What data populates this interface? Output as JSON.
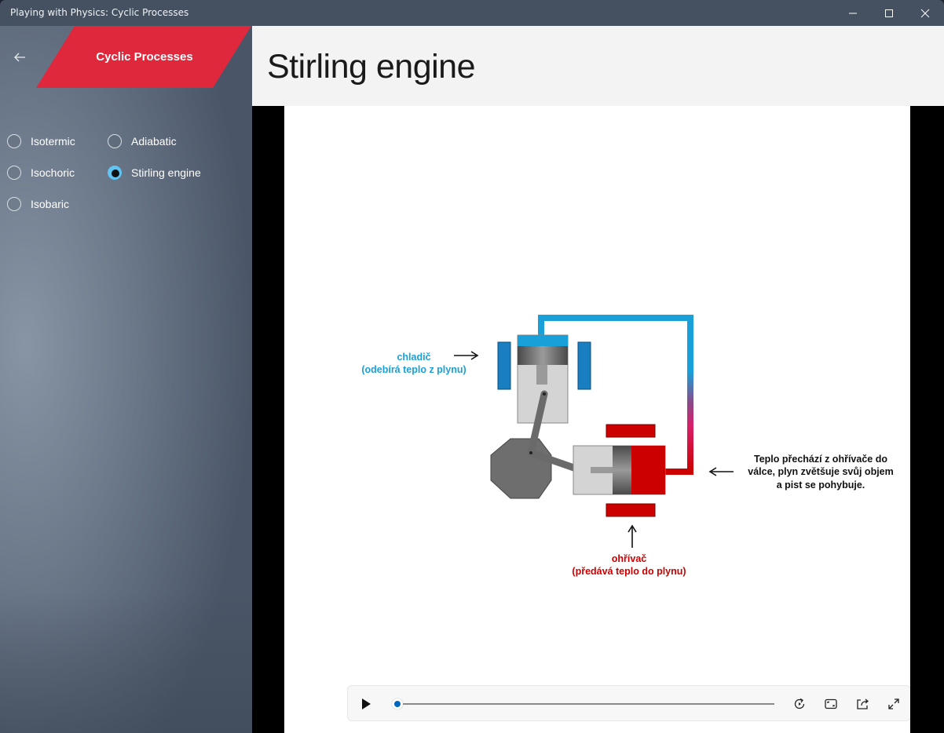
{
  "window": {
    "title": "Playing with Physics: Cyclic Processes"
  },
  "sidebar": {
    "banner_label": "Cyclic Processes",
    "accent_color": "#e0283c",
    "radio_options": [
      {
        "label": "Isotermic",
        "checked": false
      },
      {
        "label": "Adiabatic",
        "checked": false
      },
      {
        "label": "Isochoric",
        "checked": false
      },
      {
        "label": "Stirling engine",
        "checked": true
      },
      {
        "label": "Isobaric",
        "checked": false
      }
    ]
  },
  "main": {
    "page_title": "Stirling engine"
  },
  "diagram": {
    "cooler_label_1": "chladič",
    "cooler_label_2": "(odebírá teplo z plynu)",
    "heater_label_1": "ohřívač",
    "heater_label_2": "(předává teplo do plynu)",
    "note_line_1": "Teplo přechází z ohřívače do",
    "note_line_2": "válce, plyn zvětšuje svůj objem",
    "note_line_3": "a pist se pohybuje.",
    "cool_color": "#1aa0d8",
    "hot_color": "#cc0000"
  },
  "player": {
    "progress": 0,
    "icons": [
      "play-icon",
      "replay-icon",
      "aspect-ratio-icon",
      "cast-icon",
      "fullscreen-icon"
    ]
  }
}
